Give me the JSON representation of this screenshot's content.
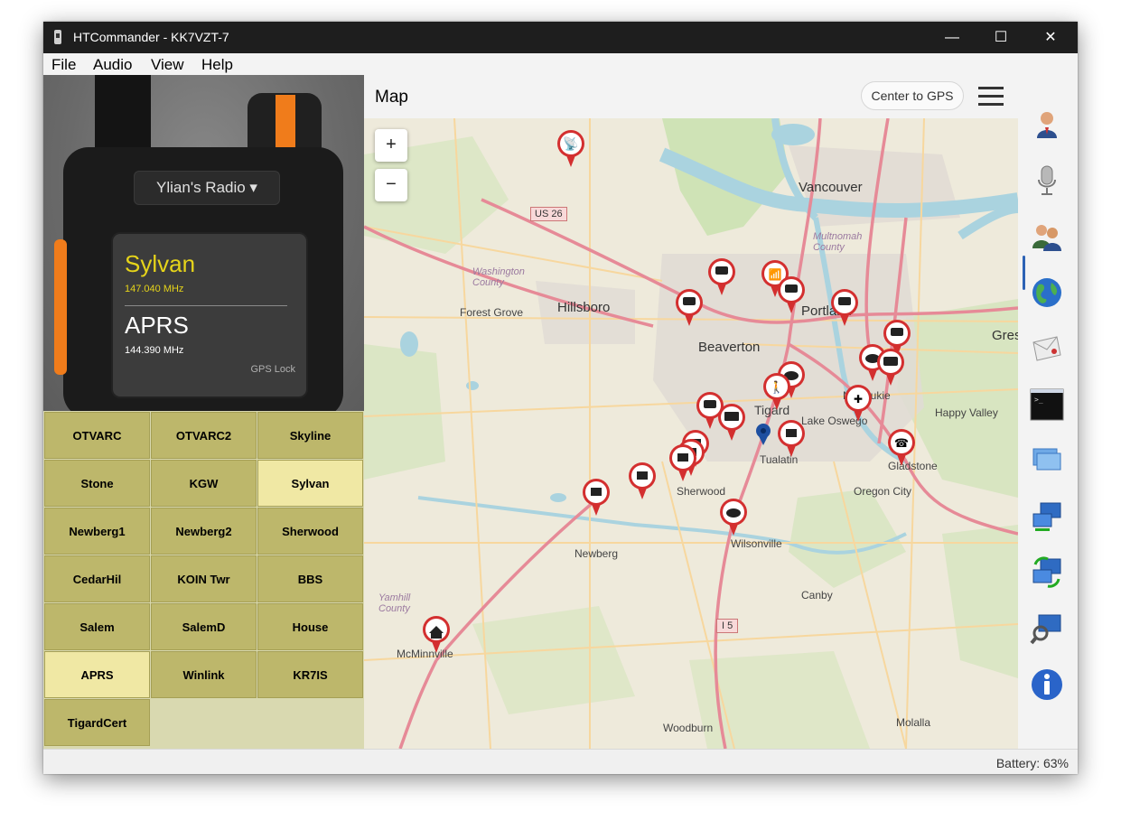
{
  "window": {
    "title": "HTCommander - KK7VZT-7",
    "minimize": "—",
    "maximize": "☐",
    "close": "✕"
  },
  "menu": [
    "File",
    "Audio",
    "View",
    "Help"
  ],
  "radio": {
    "selector": "Ylian's Radio ▾",
    "channel_a": {
      "name": "Sylvan",
      "freq": "147.040 MHz"
    },
    "channel_b": {
      "name": "APRS",
      "freq": "144.390 MHz"
    },
    "gps_status": "GPS Lock"
  },
  "channels": [
    {
      "label": "OTVARC",
      "active": false
    },
    {
      "label": "OTVARC2",
      "active": false
    },
    {
      "label": "Skyline",
      "active": false
    },
    {
      "label": "Stone",
      "active": false
    },
    {
      "label": "KGW",
      "active": false
    },
    {
      "label": "Sylvan",
      "active": true
    },
    {
      "label": "Newberg1",
      "active": false
    },
    {
      "label": "Newberg2",
      "active": false
    },
    {
      "label": "Sherwood",
      "active": false
    },
    {
      "label": "CedarHil",
      "active": false
    },
    {
      "label": "KOIN Twr",
      "active": false
    },
    {
      "label": "BBS",
      "active": false
    },
    {
      "label": "Salem",
      "active": false
    },
    {
      "label": "SalemD",
      "active": false
    },
    {
      "label": "House",
      "active": false
    },
    {
      "label": "APRS",
      "active": true
    },
    {
      "label": "Winlink",
      "active": false
    },
    {
      "label": "KR7IS",
      "active": false
    },
    {
      "label": "TigardCert",
      "active": false
    }
  ],
  "map": {
    "title": "Map",
    "center_button": "Center to GPS",
    "zoom_in": "+",
    "zoom_out": "−",
    "places": {
      "vancouver": "Vancouver",
      "hillsboro": "Hillsboro",
      "forest_grove": "Forest Grove",
      "beaverton": "Beaverton",
      "portland": "Portland",
      "gresham": "Gres",
      "tigard": "Tigard",
      "tualatin": "Tualatin",
      "lake_oswego": "Lake Oswego",
      "milwaukie": "Milwaukie",
      "happy_valley": "Happy Valley",
      "gladstone": "Gladstone",
      "oregon_city": "Oregon City",
      "sherwood": "Sherwood",
      "newberg": "Newberg",
      "wilsonville": "Wilsonville",
      "canby": "Canby",
      "mcminnville": "McMinnville",
      "woodburn": "Woodburn",
      "molalla": "Molalla",
      "washington_county": "Washington County",
      "multnomah_county": "Multnomah County",
      "yamhill_county": "Yamhill County",
      "us26": "US 26",
      "i5": "I 5"
    },
    "colors": {
      "marker": "#d32f2f",
      "gps_marker": "#1e4fa0",
      "highway": "#e8919c",
      "water": "#aad3df",
      "forest": "#c8dfb3"
    }
  },
  "sidebar_icons": [
    "contact-icon",
    "microphone-icon",
    "users-icon",
    "globe-icon",
    "mail-icon",
    "terminal-icon",
    "windows-icon",
    "network-icon",
    "sync-icon",
    "search-computer-icon",
    "info-icon"
  ],
  "status": {
    "battery": "Battery: 63%"
  }
}
